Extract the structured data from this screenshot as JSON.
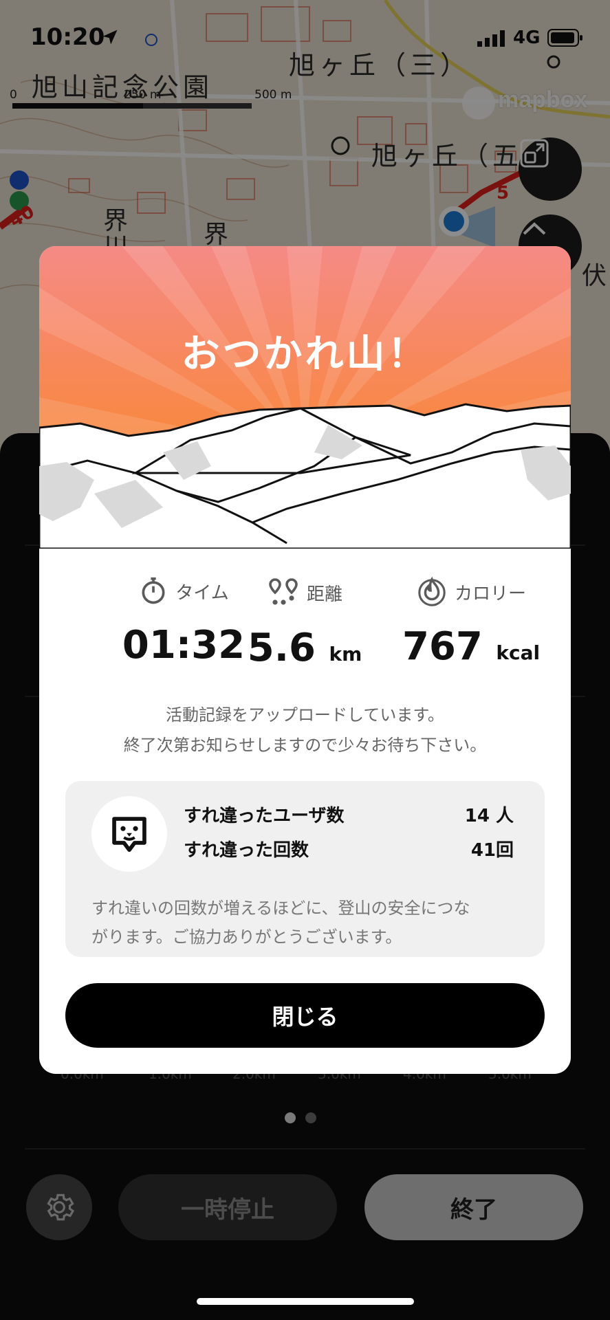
{
  "status_bar": {
    "time": "10:20",
    "network": "4G"
  },
  "map": {
    "labels": {
      "park": "旭山記念公園",
      "area_3": "旭ヶ丘（三）",
      "area_5": "旭ヶ丘（五",
      "kai1": "界",
      "kai2": "川",
      "kai3": "界",
      "fushi": "伏"
    },
    "scale": {
      "zero": "0",
      "mid": "250 m",
      "max": "500 m"
    },
    "attribution": "mapbox",
    "route_marker": "40",
    "route_marker_right": "5"
  },
  "sheet": {
    "axis_ticks": [
      "0.0km",
      "1.0km",
      "2.0km",
      "3.0km",
      "4.0km",
      "5.0km"
    ],
    "pause_label": "一時停止",
    "finish_label": "終了",
    "pager": {
      "count": 2,
      "active": 0
    }
  },
  "modal": {
    "title": "おつかれ山！",
    "stats": {
      "time": {
        "label": "タイム",
        "value": "01:32"
      },
      "distance": {
        "label": "距離",
        "value": "5.6",
        "unit": "km"
      },
      "calories": {
        "label": "カロリー",
        "value": "767",
        "unit": "kcal"
      }
    },
    "upload_message": {
      "line1": "活動記録をアップロードしています。",
      "line2": "終了次第お知らせしますので少々お待ち下さい。"
    },
    "encounter": {
      "users_label": "すれ違ったユーザ数",
      "users_value": "14 人",
      "count_label": "すれ違った回数",
      "count_value": "41回",
      "note_line1": "すれ違いの回数が増えるほどに、登山の安全につな",
      "note_line2": "がります。ご協力ありがとうございます。"
    },
    "close_label": "閉じる"
  },
  "colors": {
    "hero_top": "#f58a86",
    "hero_bottom": "#f9873a",
    "accent_blue": "#1e7bd6",
    "route_red": "#e0201b"
  }
}
